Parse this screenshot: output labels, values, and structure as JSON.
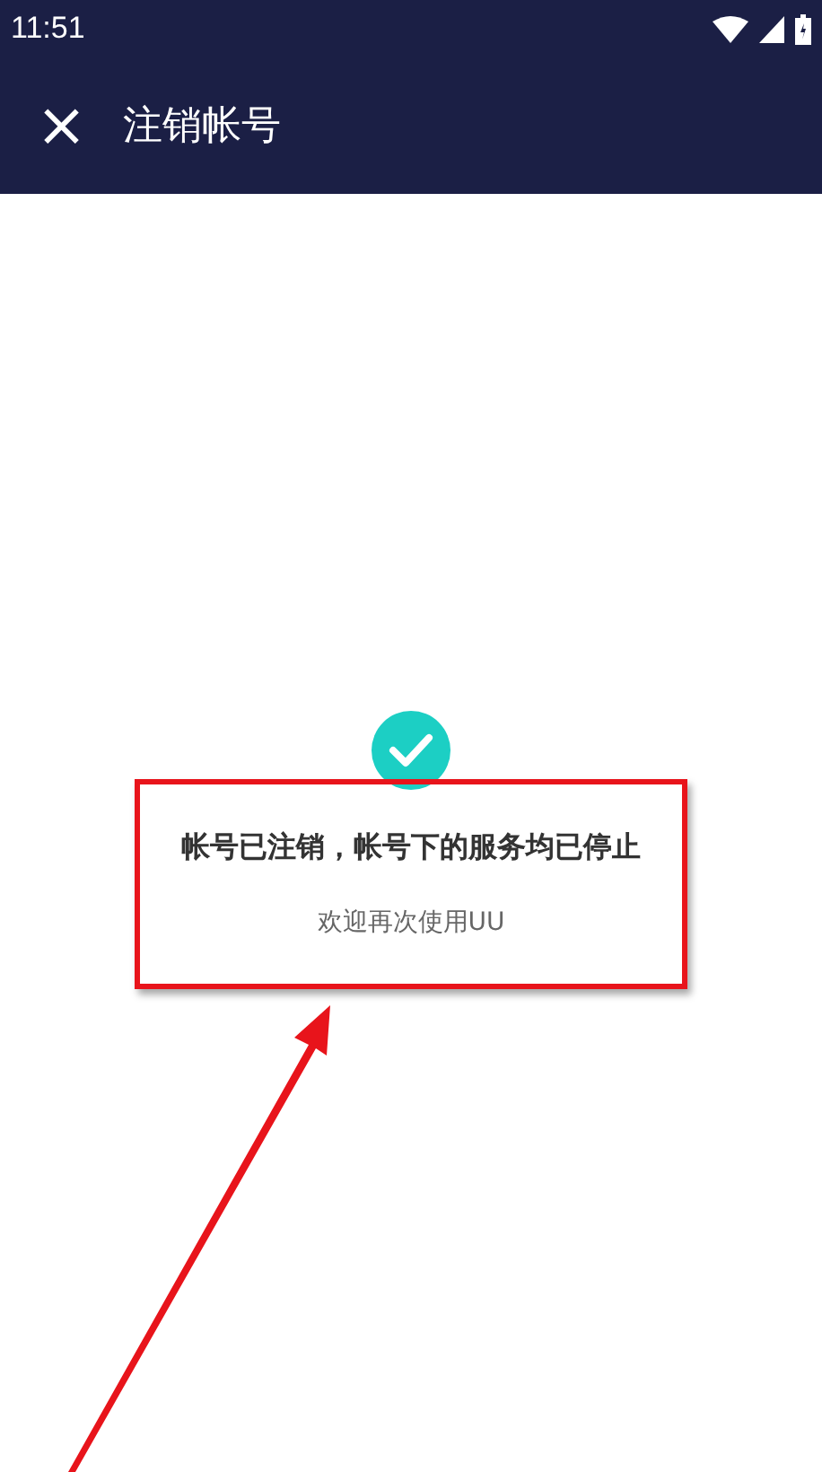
{
  "status_bar": {
    "time": "11:51"
  },
  "app_bar": {
    "close": "×",
    "title": "注销帐号"
  },
  "result": {
    "title": "帐号已注销，帐号下的服务均已停止",
    "subtitle": "欢迎再次使用UU"
  }
}
